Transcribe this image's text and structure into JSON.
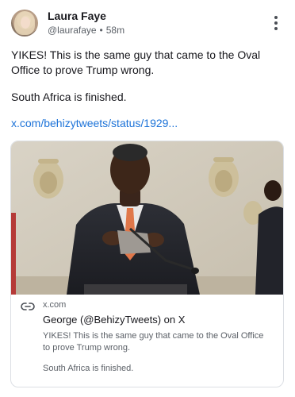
{
  "author": {
    "name": "Laura Faye",
    "handle": "@laurafaye",
    "separator": "•",
    "timestamp": "58m"
  },
  "post": {
    "text_paragraph_1": "YIKES! This is the same guy that came to the Oval Office to prove Trump wrong.",
    "text_paragraph_2": "South Africa is finished.",
    "link_text": "x.com/behizytweets/status/1929..."
  },
  "link_card": {
    "domain": "x.com",
    "title": "George (@BehizyTweets) on X",
    "description_paragraph_1": "YIKES! This is the same guy that came to the Oval Office to prove Trump wrong.",
    "description_paragraph_2": "South Africa is finished."
  },
  "icons": {
    "more": "more-vertical-icon",
    "link": "link-icon"
  },
  "colors": {
    "link": "#1d73d8",
    "muted_text": "#5b6067",
    "card_border": "#dcdfe4"
  }
}
